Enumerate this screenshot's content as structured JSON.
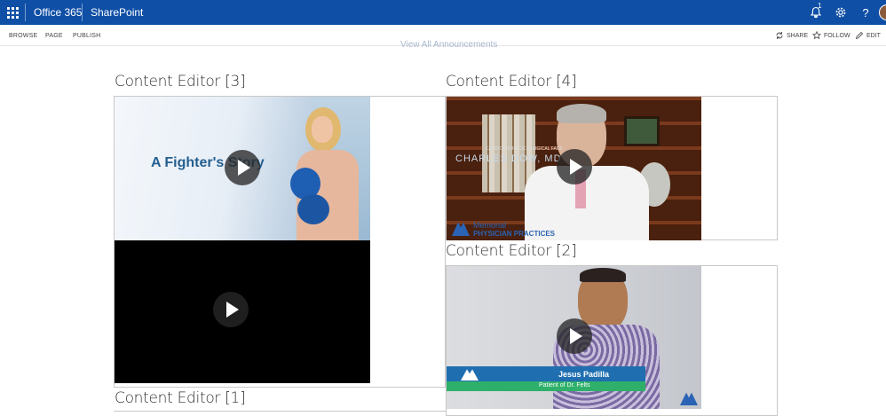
{
  "suitebar": {
    "app_name": "Office 365",
    "site_name": "SharePoint",
    "notification_count": "1",
    "icons": [
      "app-launcher-icon",
      "bell-icon",
      "gear-icon",
      "help-icon",
      "avatar"
    ]
  },
  "ribbon": {
    "tabs": [
      "BROWSE",
      "PAGE",
      "PUBLISH"
    ],
    "actions": {
      "share": "SHARE",
      "follow": "FOLLOW",
      "edit": "EDIT"
    }
  },
  "announcements_link": "View All Announcements",
  "webparts": {
    "ce3": {
      "title": "Content Editor [3]",
      "video1_text": "A Fighter's Story"
    },
    "ce4": {
      "title": "Content Editor [4]",
      "doctor_name": "CHARLES DOW, MD",
      "doctor_subtitle": "CARDIOTHORACIC SURGICAL FACS",
      "logo_line1": "Memorial",
      "logo_line2": "PHYSICIAN PRACTICES"
    },
    "ce2": {
      "title": "Content Editor [2]",
      "lower_third_name": "Jesus Padilla",
      "lower_third_subtitle": "Patient of Dr. Felts"
    },
    "ce1": {
      "title": "Content Editor [1]"
    }
  },
  "colors": {
    "suitebar": "#0f4fa6",
    "link": "#a9b8cf"
  }
}
